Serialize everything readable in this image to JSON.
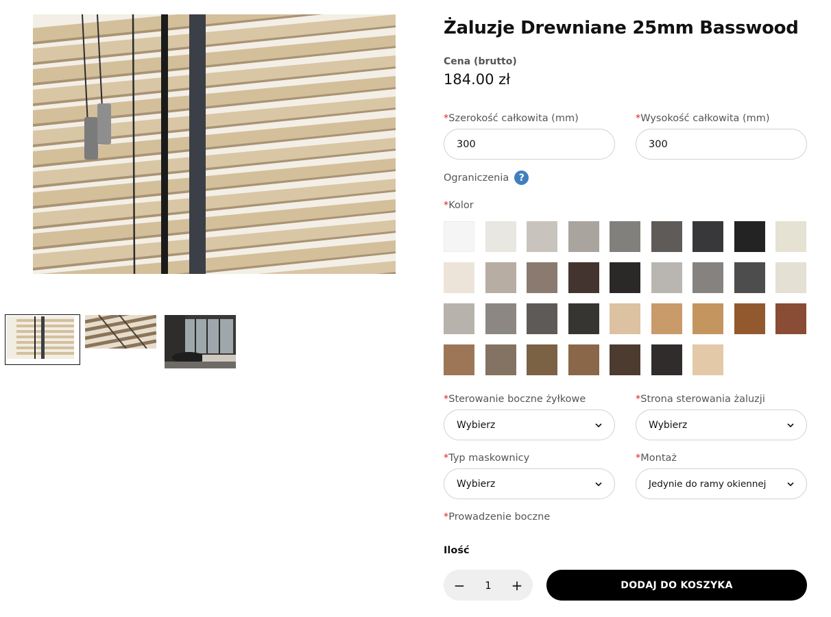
{
  "product": {
    "title": "Żaluzje Drewniane 25mm Basswood",
    "price_label": "Cena (brutto)",
    "price_value": "184.00 zł"
  },
  "dimensions": {
    "width_label": "Szerokość całkowita (mm)",
    "width_value": "300",
    "height_label": "Wysokość całkowita (mm)",
    "height_value": "300",
    "required_mark": "*"
  },
  "limits": {
    "label": "Ograniczenia",
    "help_icon": "question-icon",
    "help_glyph": "?"
  },
  "color": {
    "label": "Kolor",
    "swatches": [
      "#f4f5f4",
      "#e9e7e1",
      "#c9c3be",
      "#aaa49e",
      "#82807d",
      "#5f5b58",
      "#38383a",
      "#232323",
      "#e5e1d3",
      "#ece4d8",
      "#b7ada2",
      "#8a7a6f",
      "#43342f",
      "#2b2828",
      "#b9b6b2",
      "#85827f",
      "#4e4d4d",
      "#e4e0d3",
      "#b7b2ab",
      "#8c8782",
      "#5e5a58",
      "#373532",
      "#dcc2a1",
      "#c99a6a",
      "#c4955f",
      "#93592e",
      "#894c35",
      "#9d7657",
      "#847362",
      "#7b6245",
      "#8a6749",
      "#4d3b30",
      "#302c2b",
      "#e3c9a8"
    ]
  },
  "selects": {
    "control": {
      "label": "Sterowanie boczne żyłkowe",
      "value": "Wybierz"
    },
    "side": {
      "label": "Strona sterowania żaluzji",
      "value": "Wybierz"
    },
    "cover": {
      "label": "Typ maskownicy",
      "value": "Wybierz"
    },
    "mount": {
      "label": "Montaż",
      "value": "Jedynie do ramy okiennej"
    }
  },
  "guide": {
    "label": "Prowadzenie boczne"
  },
  "quantity": {
    "label": "Ilość",
    "value": "1",
    "minus": "−",
    "plus": "+"
  },
  "cart": {
    "button_label": "DODAJ DO KOSZYKA"
  }
}
